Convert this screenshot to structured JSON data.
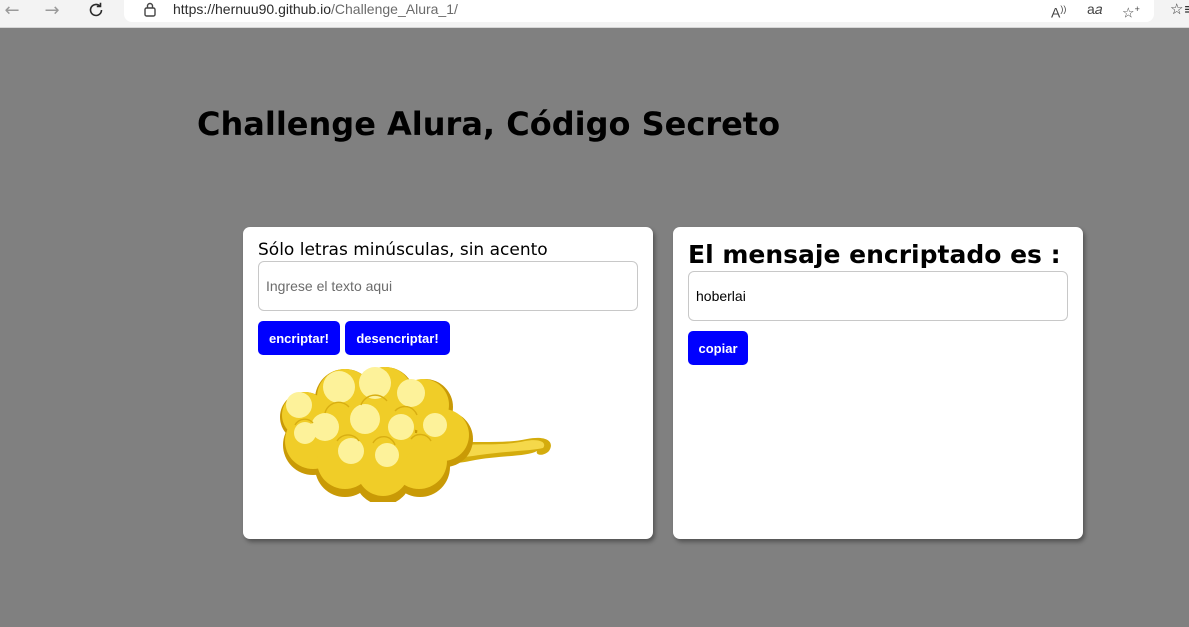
{
  "browser": {
    "url_host": "https://hernuu90.github.io",
    "url_path": "/Challenge_Alura_1/"
  },
  "page": {
    "title": "Challenge Alura, Código Secreto"
  },
  "encrypt_card": {
    "instruction": "Sólo letras minúsculas, sin acento",
    "input_value": "",
    "input_placeholder": "Ingrese el texto aqui",
    "encrypt_label": "encriptar!",
    "decrypt_label": "desencriptar!"
  },
  "result_card": {
    "title": "El mensaje encriptado es :",
    "output_value": "hoberlai",
    "copy_label": "copiar"
  },
  "icons": [
    "back-icon",
    "forward-icon",
    "refresh-icon",
    "lock-icon",
    "read-aloud-icon",
    "translate-icon",
    "add-favorite-icon",
    "favorites-icon",
    "nimbus-cloud-image"
  ],
  "colors": {
    "page_background": "#808080",
    "button_background": "#0000ff",
    "button_text": "#ffffff",
    "card_background": "#ffffff",
    "cloud_yellow": "#f2d43a"
  }
}
